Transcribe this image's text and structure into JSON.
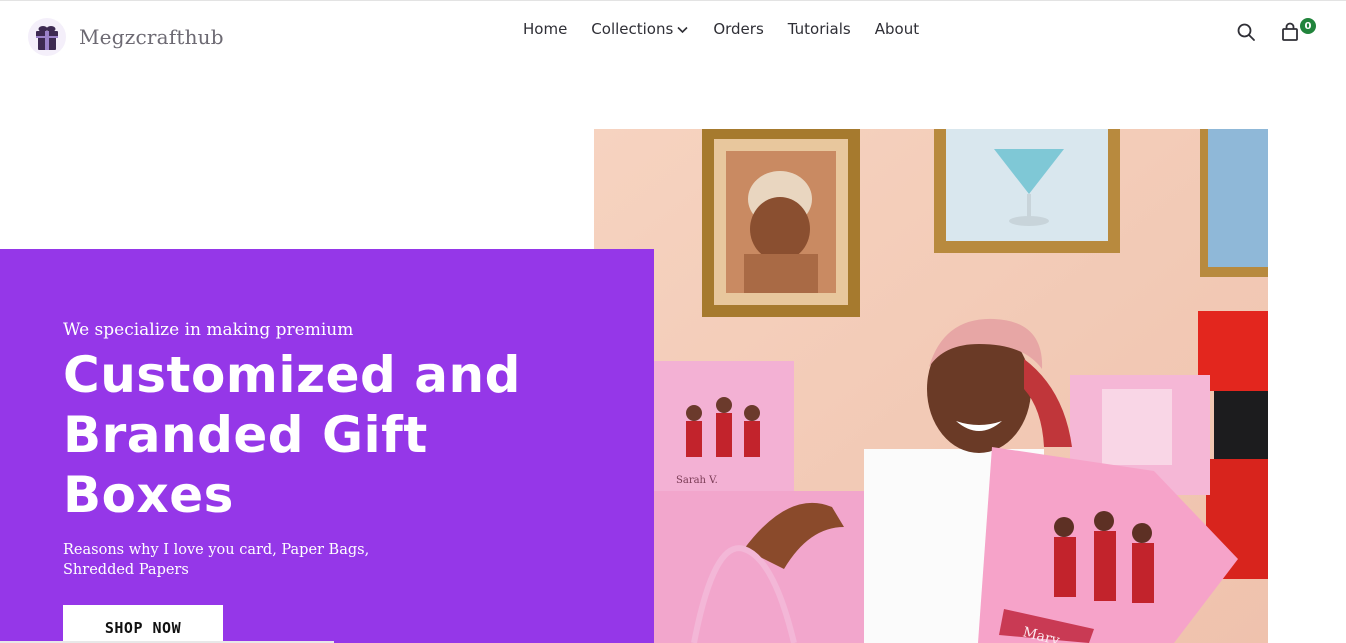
{
  "brand": {
    "name": "Megzcrafthub",
    "logo_icon": "gift-box-icon"
  },
  "nav": {
    "items": [
      {
        "label": "Home"
      },
      {
        "label": "Collections",
        "has_dropdown": true
      },
      {
        "label": "Orders"
      },
      {
        "label": "Tutorials"
      },
      {
        "label": "About"
      }
    ]
  },
  "header_actions": {
    "search_icon": "search-icon",
    "cart_icon": "shopping-bag-icon",
    "cart_count": "0"
  },
  "hero": {
    "intro": "We specialize in making premium",
    "title": "Customized and Branded Gift Boxes",
    "description": "Reasons why I love you card, Paper Bags, Shredded Papers",
    "cta_label": "SHOP NOW",
    "photo_texts": [
      "Sarah V.",
      "Mary"
    ]
  },
  "colors": {
    "accent": "#9537e8",
    "badge": "#21843c",
    "nav_text": "#2f2f36",
    "logo_text": "#6d6a73"
  }
}
